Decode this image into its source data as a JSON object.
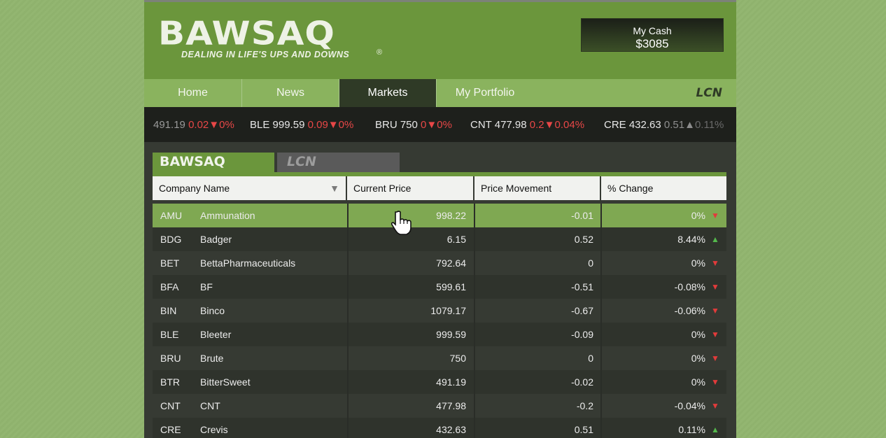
{
  "brand": {
    "name": "BAWSAQ",
    "registered": "®",
    "tagline": "DEALING IN LIFE'S UPS AND DOWNS"
  },
  "cash": {
    "label": "My Cash",
    "value": "$3085"
  },
  "nav": {
    "tabs": [
      {
        "label": "Home"
      },
      {
        "label": "News"
      },
      {
        "label": "Markets",
        "active": true
      },
      {
        "label": "My Portfolio"
      }
    ],
    "lcn_logo": "LCN"
  },
  "ticker": [
    {
      "sym": "",
      "price": "491.19",
      "change": "0.02",
      "pct": "0%",
      "dir": "down"
    },
    {
      "sym": "BLE",
      "price": "999.59",
      "change": "0.09",
      "pct": "0%",
      "dir": "down"
    },
    {
      "sym": "BRU",
      "price": "750",
      "change": "0",
      "pct": "0%",
      "dir": "down"
    },
    {
      "sym": "CNT",
      "price": "477.98",
      "change": "0.2",
      "pct": "0.04%",
      "dir": "down"
    },
    {
      "sym": "CRE",
      "price": "432.63",
      "change": "0.51",
      "pct": "0.11%",
      "dir": "up"
    }
  ],
  "exchange_tabs": {
    "bawsaq": "BAWSAQ",
    "lcn": "LCN"
  },
  "table": {
    "columns": [
      "Company Name",
      "Current Price",
      "Price Movement",
      "% Change"
    ],
    "rows": [
      {
        "sym": "AMU",
        "name": "Ammunation",
        "price": "998.22",
        "move": "-0.01",
        "pct": "0%",
        "dir": "down",
        "selected": true
      },
      {
        "sym": "BDG",
        "name": "Badger",
        "price": "6.15",
        "move": "0.52",
        "pct": "8.44%",
        "dir": "up"
      },
      {
        "sym": "BET",
        "name": "BettaPharmaceuticals",
        "price": "792.64",
        "move": "0",
        "pct": "0%",
        "dir": "down"
      },
      {
        "sym": "BFA",
        "name": "BF",
        "price": "599.61",
        "move": "-0.51",
        "pct": "-0.08%",
        "dir": "down"
      },
      {
        "sym": "BIN",
        "name": "Binco",
        "price": "1079.17",
        "move": "-0.67",
        "pct": "-0.06%",
        "dir": "down"
      },
      {
        "sym": "BLE",
        "name": "Bleeter",
        "price": "999.59",
        "move": "-0.09",
        "pct": "0%",
        "dir": "down"
      },
      {
        "sym": "BRU",
        "name": "Brute",
        "price": "750",
        "move": "0",
        "pct": "0%",
        "dir": "down"
      },
      {
        "sym": "BTR",
        "name": "BitterSweet",
        "price": "491.19",
        "move": "-0.02",
        "pct": "0%",
        "dir": "down"
      },
      {
        "sym": "CNT",
        "name": "CNT",
        "price": "477.98",
        "move": "-0.2",
        "pct": "-0.04%",
        "dir": "down"
      },
      {
        "sym": "CRE",
        "name": "Crevis",
        "price": "432.63",
        "move": "0.51",
        "pct": "0.11%",
        "dir": "up"
      }
    ]
  },
  "colors": {
    "brand_green": "#6b963c",
    "up": "#54b94c",
    "down": "#e23b3b",
    "selected_row": "#7fa852"
  }
}
